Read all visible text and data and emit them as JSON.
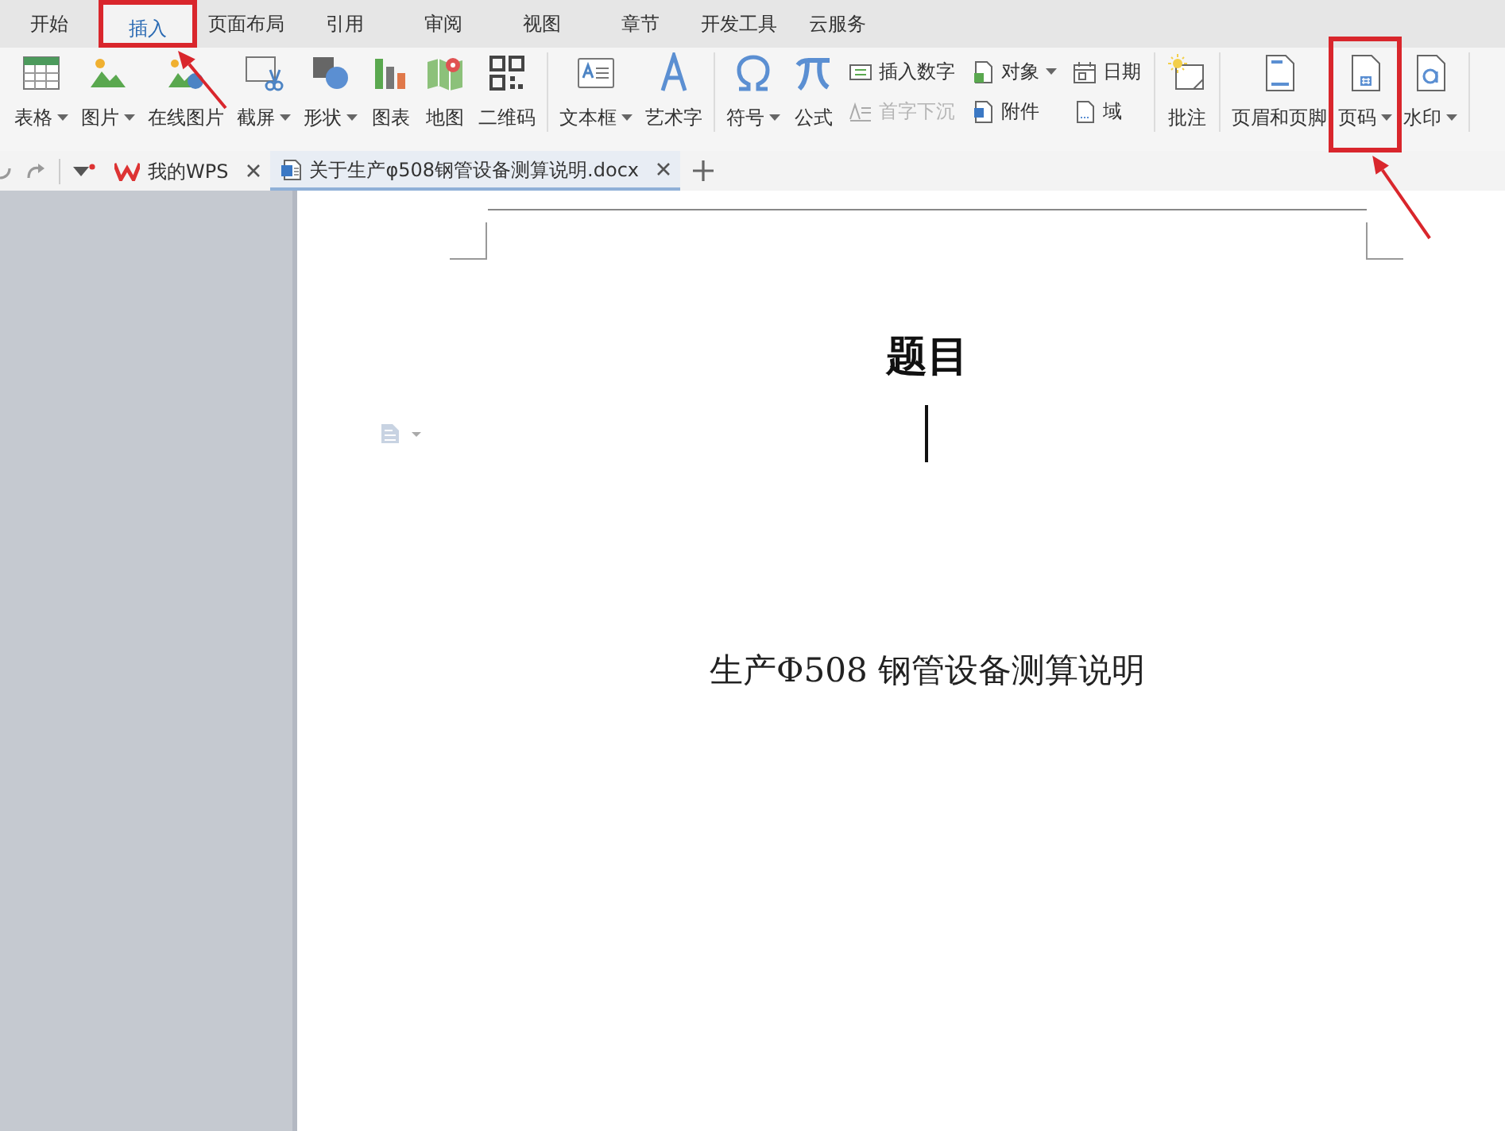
{
  "menu_tabs": [
    {
      "label": "开始",
      "selected": false,
      "highlighted": false
    },
    {
      "label": "插入",
      "selected": true,
      "highlighted": true,
      "arrow": true
    },
    {
      "label": "页面布局",
      "selected": false,
      "highlighted": false
    },
    {
      "label": "引用",
      "selected": false,
      "highlighted": false
    },
    {
      "label": "审阅",
      "selected": false,
      "highlighted": false
    },
    {
      "label": "视图",
      "selected": false,
      "highlighted": false
    },
    {
      "label": "章节",
      "selected": false,
      "highlighted": false
    },
    {
      "label": "开发工具",
      "selected": false,
      "highlighted": false
    },
    {
      "label": "云服务",
      "selected": false,
      "highlighted": false
    }
  ],
  "ribbon_groups": [
    {
      "items": [
        {
          "kind": "large",
          "label": "表格",
          "dropdown": true,
          "highlighted": false
        },
        {
          "kind": "large",
          "label": "图片",
          "dropdown": true,
          "highlighted": false
        },
        {
          "kind": "large",
          "label": "在线图片",
          "dropdown": false,
          "highlighted": false
        },
        {
          "kind": "large",
          "label": "截屏",
          "dropdown": true,
          "highlighted": false
        },
        {
          "kind": "large",
          "label": "形状",
          "dropdown": true,
          "highlighted": false
        },
        {
          "kind": "large",
          "label": "图表",
          "dropdown": false,
          "highlighted": false
        },
        {
          "kind": "large",
          "label": "地图",
          "dropdown": false,
          "highlighted": false
        },
        {
          "kind": "large",
          "label": "二维码",
          "dropdown": false,
          "highlighted": false
        }
      ]
    },
    {
      "items": [
        {
          "kind": "large",
          "label": "文本框",
          "dropdown": true,
          "highlighted": false
        },
        {
          "kind": "large",
          "label": "艺术字",
          "dropdown": false,
          "highlighted": false
        }
      ]
    },
    {
      "items": [
        {
          "kind": "large",
          "label": "符号",
          "dropdown": true,
          "highlighted": false
        },
        {
          "kind": "large",
          "label": "公式",
          "dropdown": false,
          "highlighted": false
        },
        {
          "kind": "stack",
          "rows": [
            {
              "label": "插入数字",
              "dropdown": false,
              "disabled": false
            },
            {
              "label": "首字下沉",
              "dropdown": false,
              "disabled": true
            }
          ]
        },
        {
          "kind": "stack",
          "rows": [
            {
              "label": "对象",
              "dropdown": true,
              "disabled": false
            },
            {
              "label": "附件",
              "dropdown": false,
              "disabled": false
            }
          ]
        },
        {
          "kind": "stack",
          "rows": [
            {
              "label": "日期",
              "dropdown": false,
              "disabled": false
            },
            {
              "label": "域",
              "dropdown": false,
              "disabled": false
            }
          ]
        }
      ]
    },
    {
      "items": [
        {
          "kind": "large",
          "label": "批注",
          "dropdown": false,
          "highlighted": false
        }
      ]
    },
    {
      "items": [
        {
          "kind": "large",
          "label": "页眉和页脚",
          "dropdown": false,
          "highlighted": false
        },
        {
          "kind": "large",
          "label": "页码",
          "dropdown": true,
          "highlighted": true,
          "arrow": true
        },
        {
          "kind": "large",
          "label": "水印",
          "dropdown": true,
          "highlighted": false
        }
      ]
    }
  ],
  "doc_tabs": [
    {
      "label": "我的WPS",
      "selected": false
    },
    {
      "label": "关于生产φ508钢管设备测算说明.docx",
      "selected": true
    }
  ],
  "document": {
    "title": "题目",
    "paragraph": "生产Φ508 钢管设备测算说明"
  }
}
